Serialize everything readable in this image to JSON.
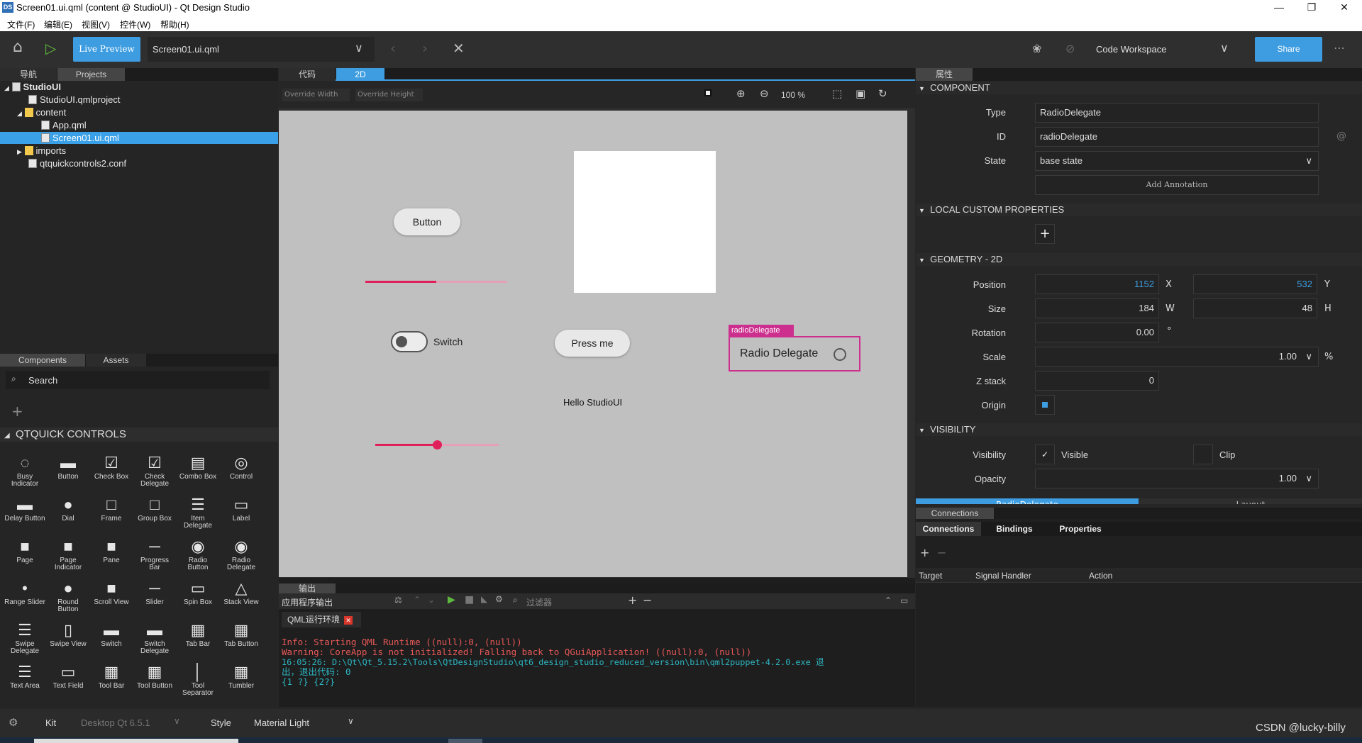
{
  "window": {
    "title": "Screen01.ui.qml (content @ StudioUI) - Qt Design Studio",
    "app_icon": "DS"
  },
  "menu": [
    "文件(F)",
    "编辑(E)",
    "视图(V)",
    "控件(W)",
    "帮助(H)"
  ],
  "toolbar": {
    "live_preview": "Live Preview",
    "file": "Screen01.ui.qml",
    "workspace": "Code Workspace",
    "share": "Share"
  },
  "left_tabs": {
    "nav": "导航",
    "projects": "Projects"
  },
  "project_tree": [
    {
      "label": "StudioUI"
    },
    {
      "label": "StudioUI.qmlproject"
    },
    {
      "label": "content"
    },
    {
      "label": "App.qml"
    },
    {
      "label": "Screen01.ui.qml"
    },
    {
      "label": "imports"
    },
    {
      "label": "qtquickcontrols2.conf"
    }
  ],
  "library": {
    "tab_components": "Components",
    "tab_assets": "Assets",
    "search": "Search",
    "section": "QTQUICK CONTROLS",
    "items": [
      "Busy\nIndicator",
      "Button",
      "Check Box",
      "Check\nDelegate",
      "Combo Box",
      "Control",
      "Delay Button",
      "Dial",
      "Frame",
      "Group Box",
      "Item\nDelegate",
      "Label",
      "Page",
      "Page\nIndicator",
      "Pane",
      "Progress Bar",
      "Radio\nButton",
      "Radio\nDelegate",
      "Range Slider",
      "Round\nButton",
      "Scroll View",
      "Slider",
      "Spin Box",
      "Stack View",
      "Swipe\nDelegate",
      "Swipe View",
      "Switch",
      "Switch\nDelegate",
      "Tab Bar",
      "Tab Button",
      "Text Area",
      "Text Field",
      "Tool Bar",
      "Tool Button",
      "Tool\nSeparator",
      "Tumbler"
    ]
  },
  "editor": {
    "tab_code": "代码",
    "tab_2d": "2D",
    "override_width": "Override Width",
    "override_height": "Override Height",
    "zoom": "100 %"
  },
  "canvas": {
    "button": "Button",
    "switch": "Switch",
    "press_me": "Press me",
    "radio_tag": "radioDelegate",
    "radio_label": "Radio Delegate",
    "hello": "Hello StudioUI",
    "progress": 0.5,
    "slider": 0.5
  },
  "output": {
    "tab": "输出",
    "header": "应用程序输出",
    "filter": "过滤器",
    "env_tab": "QML运行环境",
    "lines": [
      "Info: Starting QML Runtime ((null):0, (null))",
      "Warning: CoreApp is not initialized! Falling back to QGuiApplication! ((null):0, (null))",
      "16:05:26: D:\\Qt\\Qt_5.15.2\\Tools\\QtDesignStudio\\qt6_design_studio_reduced_version\\bin\\qml2puppet-4.2.0.exe 退",
      "出，退出代码: 0",
      " {1 ?} {2?}"
    ]
  },
  "properties": {
    "tab": "属性",
    "component_hdr": "COMPONENT",
    "type_label": "Type",
    "type_value": "RadioDelegate",
    "id_label": "ID",
    "id_value": "radioDelegate",
    "state_label": "State",
    "state_value": "base state",
    "add_annotation": "Add Annotation",
    "local_hdr": "LOCAL CUSTOM PROPERTIES",
    "geometry_hdr": "GEOMETRY - 2D",
    "position_label": "Position",
    "pos_x": "1152",
    "x": "X",
    "pos_y": "532",
    "y": "Y",
    "size_label": "Size",
    "w_val": "184",
    "w": "W",
    "h_val": "48",
    "h": "H",
    "rotation_label": "Rotation",
    "rotation": "0.00",
    "deg": "°",
    "scale_label": "Scale",
    "scale": "1.00",
    "pct": "%",
    "z_label": "Z stack",
    "z": "0",
    "origin_label": "Origin",
    "visibility_hdr": "VISIBILITY",
    "visibility_label": "Visibility",
    "visible": "Visible",
    "clip": "Clip",
    "opacity_label": "Opacity",
    "opacity": "1.00",
    "bottom_tab_left": "RadioDelegate",
    "bottom_tab_right": "Layout"
  },
  "connections": {
    "tab": "Connections",
    "tabs": [
      "Connections",
      "Bindings",
      "Properties"
    ],
    "cols": [
      "Target",
      "Signal Handler",
      "Action"
    ]
  },
  "statusbar": {
    "kit_label": "Kit",
    "kit": "Desktop Qt 6.5.1",
    "style_label": "Style",
    "style": "Material Light",
    "watermark": "CSDN @lucky-billy"
  },
  "colors": {
    "accent": "#3d9de0",
    "canvas_bg": "#c0c0c0",
    "pink": "#e0205a",
    "select": "#cc2f8e"
  }
}
